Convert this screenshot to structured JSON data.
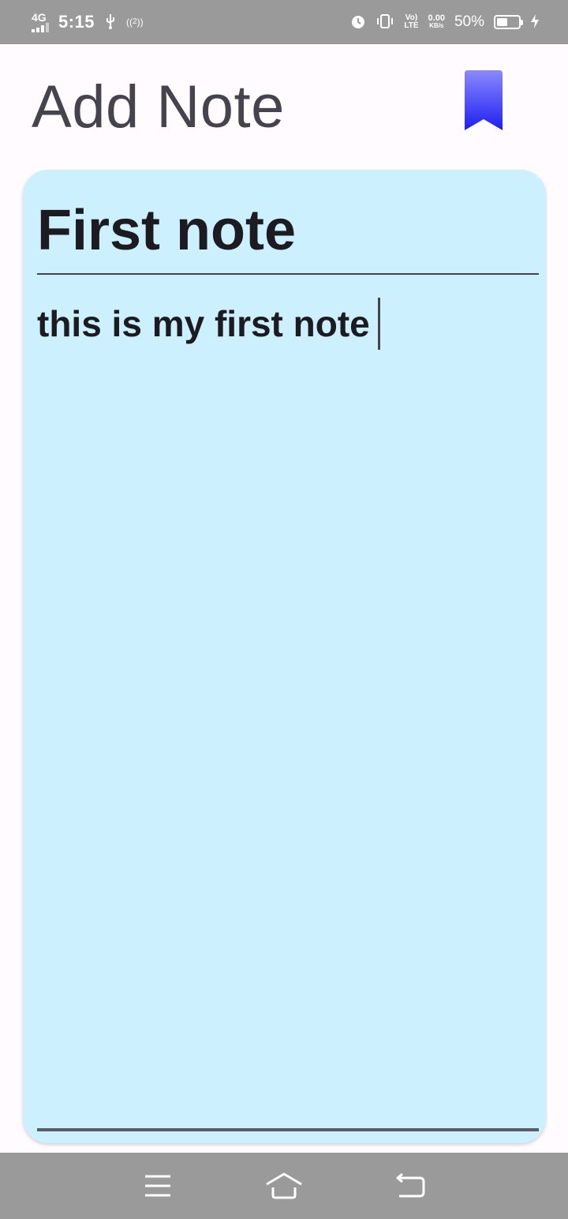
{
  "status_bar": {
    "network_type": "4G",
    "time": "5:15",
    "usb_icon": "usb-icon",
    "hotspot_icon": "hotspot-icon",
    "hotspot_count": "2",
    "alarm_icon": "alarm-icon",
    "vibrate_icon": "vibrate-icon",
    "volte_top": "Vo)",
    "volte_bottom": "LTE",
    "speed_value": "0.00",
    "speed_unit": "KB/s",
    "battery_percent": "50%",
    "battery_level": 0.5,
    "charging_icon": "charging-icon"
  },
  "header": {
    "title": "Add Note",
    "bookmark_icon": "bookmark-icon"
  },
  "note": {
    "title_value": "First note",
    "body_value": "this is my first note",
    "background": "#ccf0fe"
  },
  "nav_bar": {
    "menu_icon": "menu-icon",
    "home_icon": "home-icon",
    "back_icon": "back-icon"
  },
  "colors": {
    "status_bar": "#9a9a9a",
    "accent_bookmark": "#2a2af5",
    "title_text": "#44434e"
  }
}
